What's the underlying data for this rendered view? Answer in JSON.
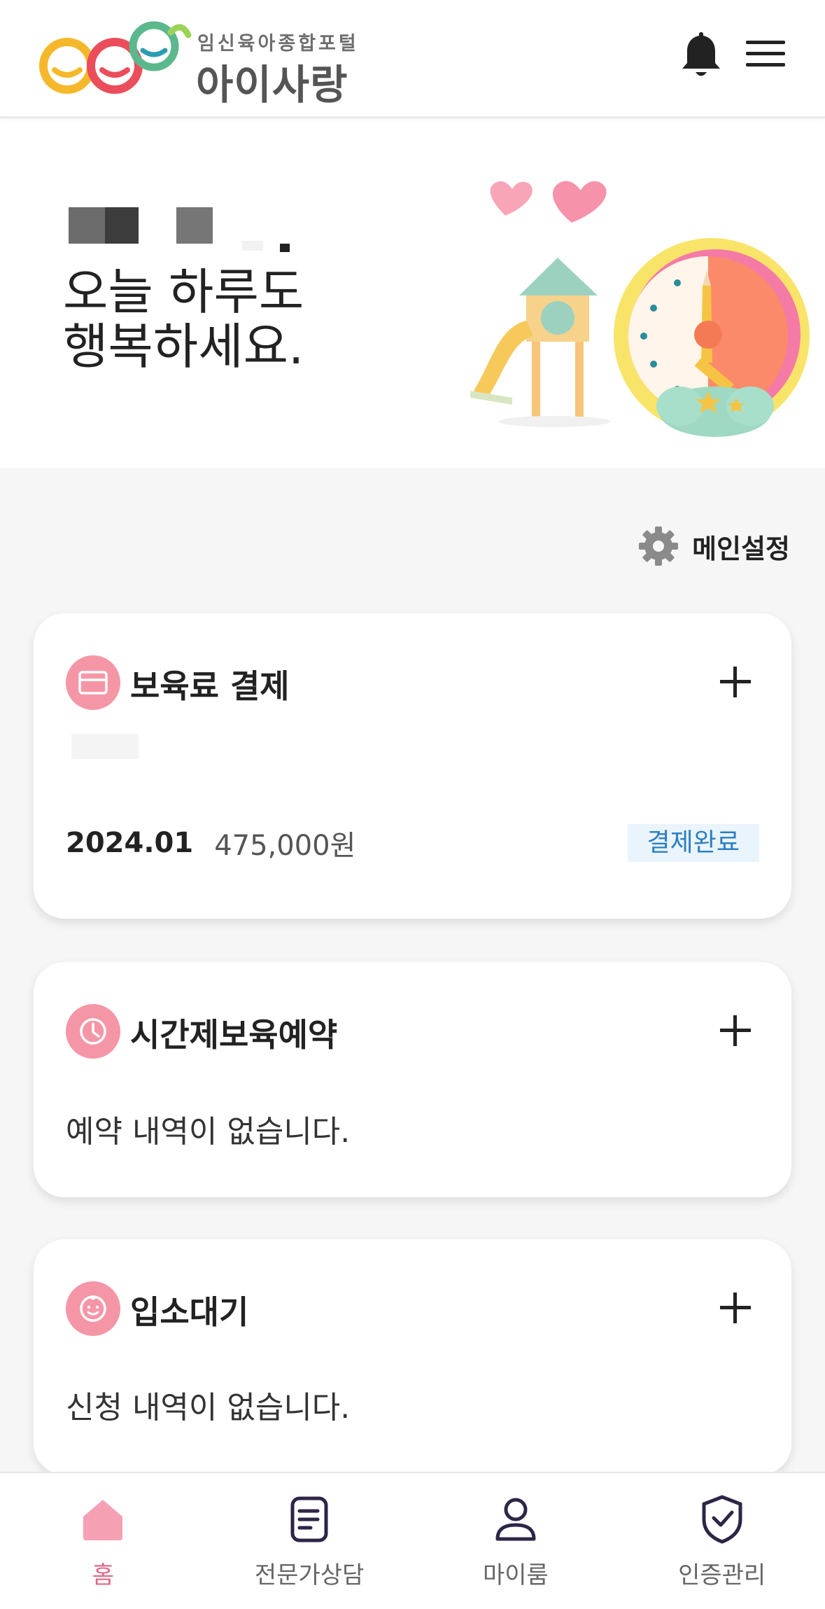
{
  "header": {
    "logo_subtitle": "임신육아종합포털",
    "logo_title": "아이사랑",
    "bell_icon": "bell-icon",
    "menu_icon": "hamburger-menu-icon"
  },
  "hero": {
    "greeting_line1": "오늘 하루도",
    "greeting_line2": "행복하세요."
  },
  "settings": {
    "label": "메인설정",
    "icon": "gear-icon"
  },
  "cards": {
    "payment": {
      "title": "보육료 결제",
      "icon": "credit-card-icon",
      "month": "2024.01",
      "amount": "475,000원",
      "status": "결제완료"
    },
    "hourly": {
      "title": "시간제보육예약",
      "icon": "clock-icon",
      "empty_text": "예약 내역이 없습니다."
    },
    "waitlist": {
      "title": "입소대기",
      "icon": "baby-face-icon",
      "empty_text": "신청 내역이 없습니다."
    }
  },
  "bottom_nav": {
    "items": [
      {
        "label": "홈",
        "icon": "home-icon",
        "active": true
      },
      {
        "label": "전문가상담",
        "icon": "document-icon",
        "active": false
      },
      {
        "label": "마이룸",
        "icon": "person-icon",
        "active": false
      },
      {
        "label": "인증관리",
        "icon": "shield-check-icon",
        "active": false
      }
    ]
  },
  "colors": {
    "accent_pink": "#f596a6",
    "active_nav": "#e26a87",
    "badge_bg": "#eaf4fc",
    "badge_text": "#2d7fc1",
    "background": "#f6f6f6"
  }
}
